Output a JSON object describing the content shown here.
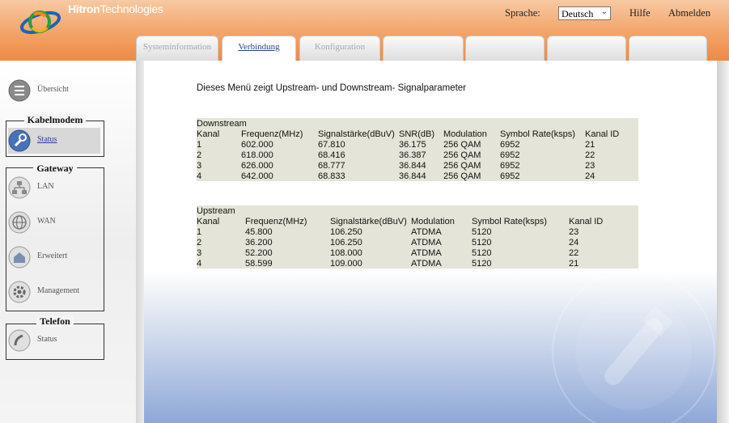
{
  "header": {
    "brand_bold": "Hitron",
    "brand_light": "Technologies",
    "language_label": "Sprache:",
    "language_value": "Deutsch",
    "help_label": "Hilfe",
    "logout_label": "Abmelden"
  },
  "tabs": [
    {
      "label": "Systeminformation",
      "active": false
    },
    {
      "label": "Verbindung",
      "active": true
    },
    {
      "label": "Konfiguration",
      "active": false
    },
    {
      "label": "",
      "active": false
    },
    {
      "label": "",
      "active": false
    },
    {
      "label": "",
      "active": false
    },
    {
      "label": "",
      "active": false
    }
  ],
  "sidebar": {
    "overview": "Übersicht",
    "cable_modem": {
      "title": "Kabelmodem",
      "status": "Status"
    },
    "gateway": {
      "title": "Gateway",
      "items": [
        "LAN",
        "WAN",
        "Erweitert",
        "Management"
      ]
    },
    "phone": {
      "title": "Telefon",
      "status": "Status"
    }
  },
  "intro": "Dieses Menü zeigt Upstream- und Downstream- Signalparameter",
  "downstream": {
    "caption": "Downstream",
    "headers": [
      "Kanal",
      "Frequenz(MHz)",
      "Signalstärke(dBuV)",
      "SNR(dB)",
      "Modulation",
      "Symbol Rate(ksps)",
      "Kanal ID"
    ],
    "rows": [
      [
        "1",
        "602.000",
        "67.810",
        "36.175",
        "256 QAM",
        "6952",
        "21"
      ],
      [
        "2",
        "618.000",
        "68.416",
        "36.387",
        "256 QAM",
        "6952",
        "22"
      ],
      [
        "3",
        "626.000",
        "68.777",
        "36.844",
        "256 QAM",
        "6952",
        "23"
      ],
      [
        "4",
        "642.000",
        "68.833",
        "36.844",
        "256 QAM",
        "6952",
        "24"
      ]
    ]
  },
  "upstream": {
    "caption": "Upstream",
    "headers": [
      "Kanal",
      "Frequenz(MHz)",
      "Signalstärke(dBuV)",
      "Modulation",
      "Symbol Rate(ksps)",
      "Kanal ID"
    ],
    "rows": [
      [
        "1",
        "45.800",
        "106.250",
        "ATDMA",
        "5120",
        "23"
      ],
      [
        "2",
        "36.200",
        "106.250",
        "ATDMA",
        "5120",
        "24"
      ],
      [
        "3",
        "52.200",
        "108.000",
        "ATDMA",
        "5120",
        "22"
      ],
      [
        "4",
        "58.599",
        "109.000",
        "ATDMA",
        "5120",
        "21"
      ]
    ]
  }
}
